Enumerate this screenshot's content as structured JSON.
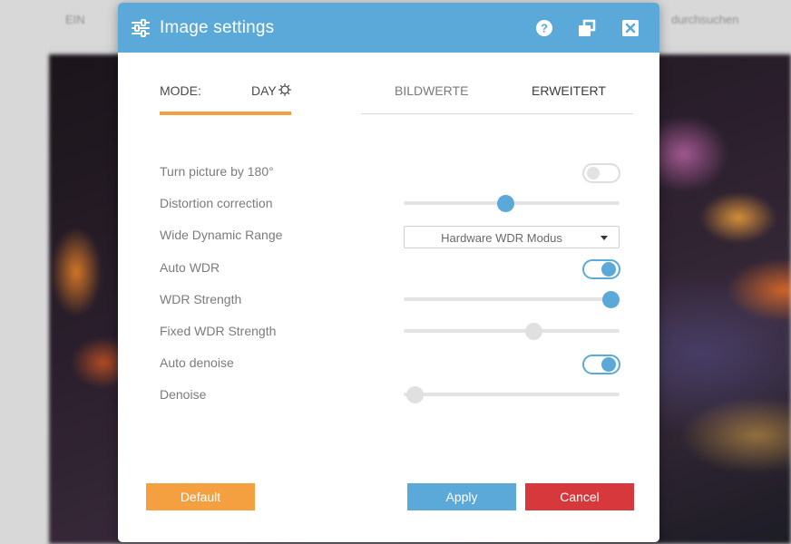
{
  "background": {
    "topbar_left_text": "EIN",
    "topbar_right_text": "durchsuchen"
  },
  "dialog": {
    "title": "Image settings",
    "title_icon": "sliders-icon",
    "toolbar_icons": [
      "help-icon",
      "restore-window-icon",
      "close-icon"
    ]
  },
  "mode": {
    "label": "MODE:",
    "value": "DAY",
    "icon": "sun-icon"
  },
  "tabs": [
    {
      "label": "BILDWERTE",
      "active": false
    },
    {
      "label": "ERWEITERT",
      "active": true
    }
  ],
  "settings": {
    "turn_picture": {
      "label": "Turn picture by 180°",
      "enabled": false
    },
    "distortion_correction": {
      "label": "Distortion correction",
      "value_fraction": 0.47
    },
    "wide_dynamic_range": {
      "label": "Wide Dynamic Range",
      "selected": "Hardware WDR Modus"
    },
    "auto_wdr": {
      "label": "Auto WDR",
      "enabled": true
    },
    "wdr_strength": {
      "label": "WDR Strength",
      "value_fraction": 0.96
    },
    "fixed_wdr_strength": {
      "label": "Fixed WDR Strength",
      "value_fraction": 0.6,
      "disabled": true
    },
    "auto_denoise": {
      "label": "Auto denoise",
      "enabled": true
    },
    "denoise": {
      "label": "Denoise",
      "value_fraction": 0.05,
      "disabled": true
    }
  },
  "buttons": {
    "default": "Default",
    "apply": "Apply",
    "cancel": "Cancel"
  },
  "colors": {
    "accent_blue": "#5ba9d8",
    "accent_orange": "#f4a041",
    "cancel_red": "#d7383c"
  }
}
